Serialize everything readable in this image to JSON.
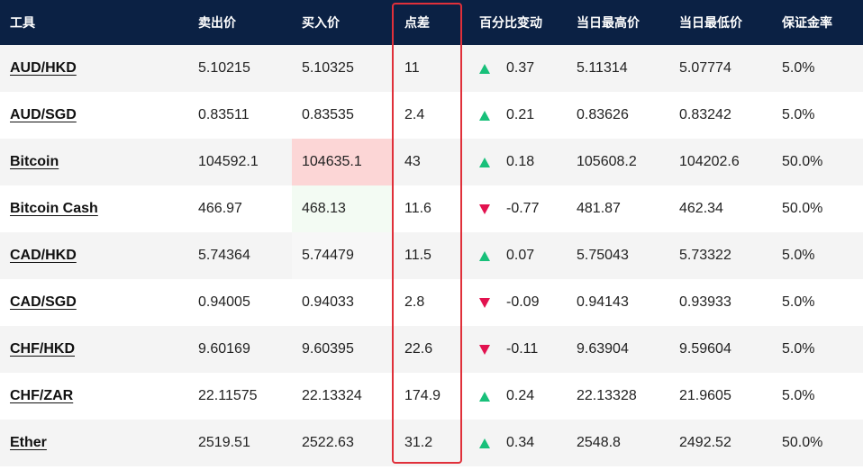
{
  "header": {
    "instrument": "工具",
    "sell": "卖出价",
    "buy": "买入价",
    "spread": "点差",
    "pct_change": "百分比变动",
    "high": "当日最高价",
    "low": "当日最低价",
    "margin": "保证金率"
  },
  "colors": {
    "header_bg": "#0b2144",
    "up": "#18c07a",
    "down": "#e2124f",
    "highlight_box": "#e0303a"
  },
  "rows": [
    {
      "instrument": "AUD/HKD",
      "sell": "5.10215",
      "buy": "5.10325",
      "spread": "11",
      "direction": "up",
      "pct": "0.37",
      "high": "5.11314",
      "low": "5.07774",
      "margin": "5.0%"
    },
    {
      "instrument": "AUD/SGD",
      "sell": "0.83511",
      "buy": "0.83535",
      "spread": "2.4",
      "direction": "up",
      "pct": "0.21",
      "high": "0.83626",
      "low": "0.83242",
      "margin": "5.0%"
    },
    {
      "instrument": "Bitcoin",
      "sell": "104592.1",
      "buy": "104635.1",
      "spread": "43",
      "direction": "up",
      "pct": "0.18",
      "high": "105608.2",
      "low": "104202.6",
      "margin": "50.0%"
    },
    {
      "instrument": "Bitcoin Cash",
      "sell": "466.97",
      "buy": "468.13",
      "spread": "11.6",
      "direction": "down",
      "pct": "-0.77",
      "high": "481.87",
      "low": "462.34",
      "margin": "50.0%"
    },
    {
      "instrument": "CAD/HKD",
      "sell": "5.74364",
      "buy": "5.74479",
      "spread": "11.5",
      "direction": "up",
      "pct": "0.07",
      "high": "5.75043",
      "low": "5.73322",
      "margin": "5.0%"
    },
    {
      "instrument": "CAD/SGD",
      "sell": "0.94005",
      "buy": "0.94033",
      "spread": "2.8",
      "direction": "down",
      "pct": "-0.09",
      "high": "0.94143",
      "low": "0.93933",
      "margin": "5.0%"
    },
    {
      "instrument": "CHF/HKD",
      "sell": "9.60169",
      "buy": "9.60395",
      "spread": "22.6",
      "direction": "down",
      "pct": "-0.11",
      "high": "9.63904",
      "low": "9.59604",
      "margin": "5.0%"
    },
    {
      "instrument": "CHF/ZAR",
      "sell": "22.11575",
      "buy": "22.13324",
      "spread": "174.9",
      "direction": "up",
      "pct": "0.24",
      "high": "22.13328",
      "low": "21.9605",
      "margin": "5.0%"
    },
    {
      "instrument": "Ether",
      "sell": "2519.51",
      "buy": "2522.63",
      "spread": "31.2",
      "direction": "up",
      "pct": "0.34",
      "high": "2548.8",
      "low": "2492.52",
      "margin": "50.0%"
    }
  ]
}
